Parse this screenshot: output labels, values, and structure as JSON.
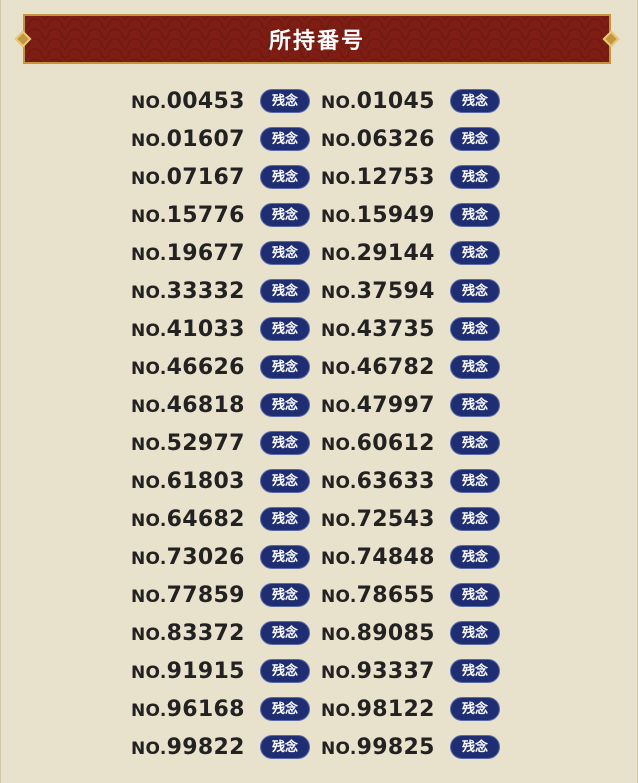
{
  "header": {
    "title": "所持番号"
  },
  "numbers": [
    {
      "prefix": "NO.",
      "value": "00453",
      "status": "残念"
    },
    {
      "prefix": "NO.",
      "value": "01045",
      "status": "残念"
    },
    {
      "prefix": "NO.",
      "value": "01607",
      "status": "残念"
    },
    {
      "prefix": "NO.",
      "value": "06326",
      "status": "残念"
    },
    {
      "prefix": "NO.",
      "value": "07167",
      "status": "残念"
    },
    {
      "prefix": "NO.",
      "value": "12753",
      "status": "残念"
    },
    {
      "prefix": "NO.",
      "value": "15776",
      "status": "残念"
    },
    {
      "prefix": "NO.",
      "value": "15949",
      "status": "残念"
    },
    {
      "prefix": "NO.",
      "value": "19677",
      "status": "残念"
    },
    {
      "prefix": "NO.",
      "value": "29144",
      "status": "残念"
    },
    {
      "prefix": "NO.",
      "value": "33332",
      "status": "残念"
    },
    {
      "prefix": "NO.",
      "value": "37594",
      "status": "残念"
    },
    {
      "prefix": "NO.",
      "value": "41033",
      "status": "残念"
    },
    {
      "prefix": "NO.",
      "value": "43735",
      "status": "残念"
    },
    {
      "prefix": "NO.",
      "value": "46626",
      "status": "残念"
    },
    {
      "prefix": "NO.",
      "value": "46782",
      "status": "残念"
    },
    {
      "prefix": "NO.",
      "value": "46818",
      "status": "残念"
    },
    {
      "prefix": "NO.",
      "value": "47997",
      "status": "残念"
    },
    {
      "prefix": "NO.",
      "value": "52977",
      "status": "残念"
    },
    {
      "prefix": "NO.",
      "value": "60612",
      "status": "残念"
    },
    {
      "prefix": "NO.",
      "value": "61803",
      "status": "残念"
    },
    {
      "prefix": "NO.",
      "value": "63633",
      "status": "残念"
    },
    {
      "prefix": "NO.",
      "value": "64682",
      "status": "残念"
    },
    {
      "prefix": "NO.",
      "value": "72543",
      "status": "残念"
    },
    {
      "prefix": "NO.",
      "value": "73026",
      "status": "残念"
    },
    {
      "prefix": "NO.",
      "value": "74848",
      "status": "残念"
    },
    {
      "prefix": "NO.",
      "value": "77859",
      "status": "残念"
    },
    {
      "prefix": "NO.",
      "value": "78655",
      "status": "残念"
    },
    {
      "prefix": "NO.",
      "value": "83372",
      "status": "残念"
    },
    {
      "prefix": "NO.",
      "value": "89085",
      "status": "残念"
    },
    {
      "prefix": "NO.",
      "value": "91915",
      "status": "残念"
    },
    {
      "prefix": "NO.",
      "value": "93337",
      "status": "残念"
    },
    {
      "prefix": "NO.",
      "value": "96168",
      "status": "残念"
    },
    {
      "prefix": "NO.",
      "value": "98122",
      "status": "残念"
    },
    {
      "prefix": "NO.",
      "value": "99822",
      "status": "残念"
    },
    {
      "prefix": "NO.",
      "value": "99825",
      "status": "残念"
    }
  ],
  "colors": {
    "header_bg": "#7d1d14",
    "header_border": "#c4953c",
    "badge_bg": "#1f2e72",
    "page_bg": "#e8e1cb"
  }
}
